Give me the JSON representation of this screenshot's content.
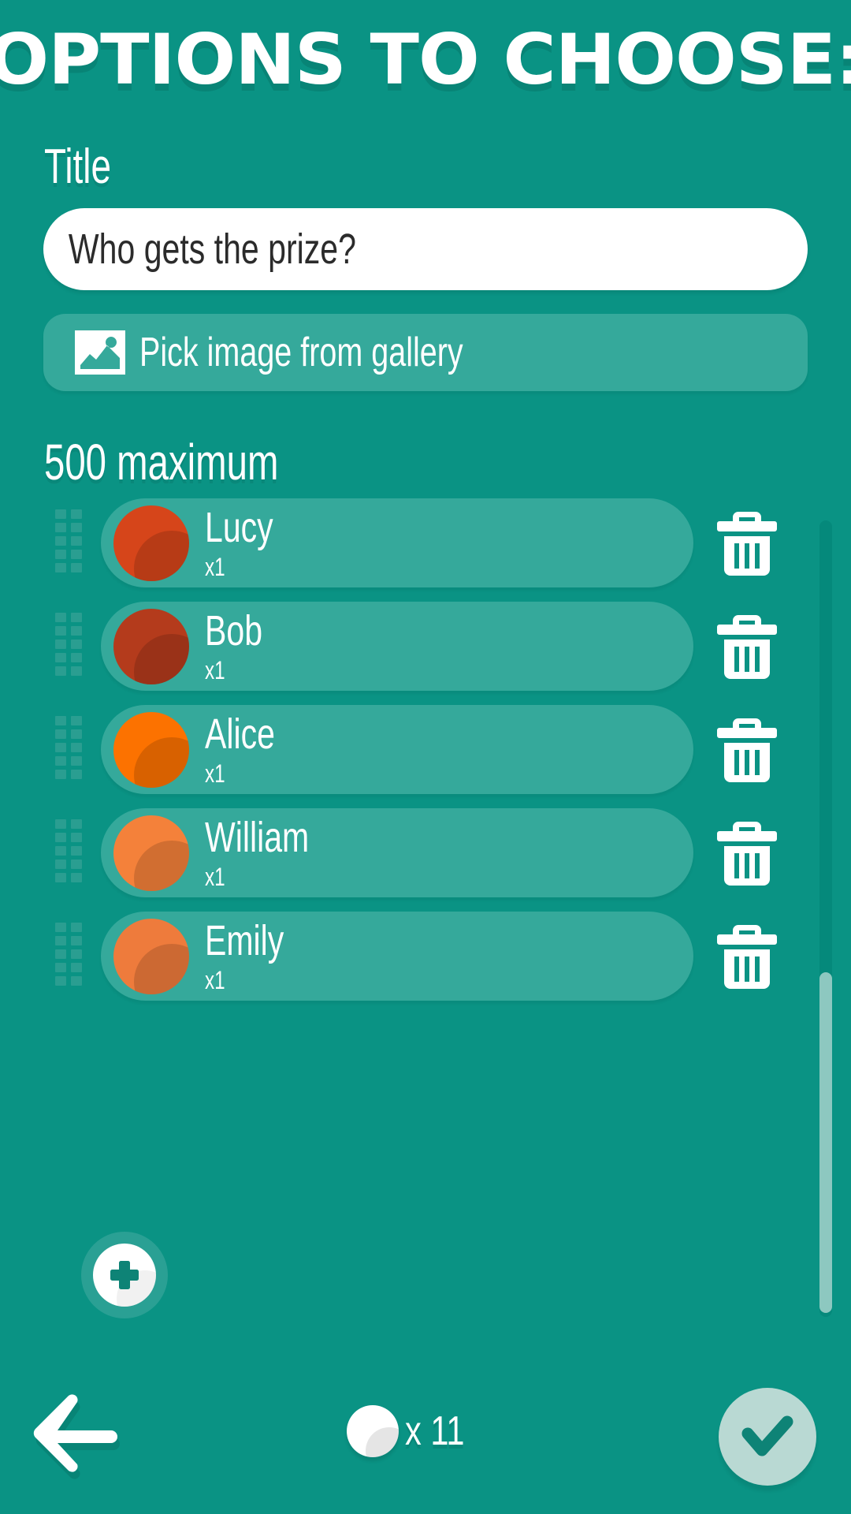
{
  "theme": {
    "background": "#0A9384",
    "surface": "#35A99B",
    "accent_dark": "#05897B",
    "text_on_dark": "#ffffff",
    "scroll_thumb": "#8DC8C0",
    "confirm_bg": "#B9D9D3",
    "confirm_check": "#0E8376"
  },
  "header": {
    "title": "Options to choose:"
  },
  "title_field": {
    "label": "Title",
    "value": "Who gets the prize?",
    "placeholder": "Title"
  },
  "gallery_button": {
    "label": "Pick image from gallery",
    "icon": "image-icon"
  },
  "list_section": {
    "max_label": "500 maximum",
    "max_count": 500,
    "options": [
      {
        "name": "Lucy",
        "count_label": "x1",
        "count": 1,
        "color": "#D6451A",
        "drag_icon": "drag-handle-icon",
        "delete_icon": "trash-icon"
      },
      {
        "name": "Bob",
        "count_label": "x1",
        "count": 1,
        "color": "#B43B1C",
        "drag_icon": "drag-handle-icon",
        "delete_icon": "trash-icon"
      },
      {
        "name": "Alice",
        "count_label": "x1",
        "count": 1,
        "color": "#FC7200",
        "drag_icon": "drag-handle-icon",
        "delete_icon": "trash-icon"
      },
      {
        "name": "William",
        "count_label": "x1",
        "count": 1,
        "color": "#F4813A",
        "drag_icon": "drag-handle-icon",
        "delete_icon": "trash-icon"
      },
      {
        "name": "Emily",
        "count_label": "x1",
        "count": 1,
        "color": "#EE7B3C",
        "drag_icon": "drag-handle-icon",
        "delete_icon": "trash-icon"
      }
    ]
  },
  "add_button": {
    "icon": "plus-icon"
  },
  "bottom_bar": {
    "back_icon": "arrow-left-icon",
    "coin_icon": "coin-icon",
    "coin_count_label": "x 11",
    "coin_count": 11,
    "confirm_icon": "check-icon"
  }
}
